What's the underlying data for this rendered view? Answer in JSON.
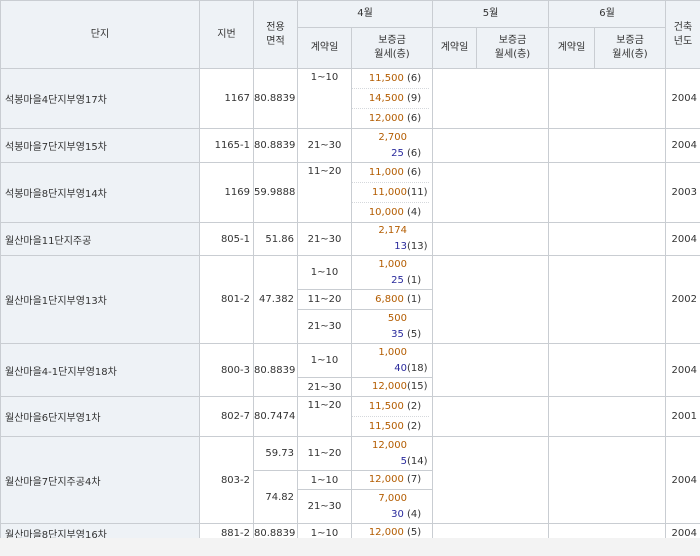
{
  "headers": {
    "danji": "단지",
    "jibun": "지번",
    "area": "전용\n면적",
    "month4": "4월",
    "month5": "5월",
    "month6": "6월",
    "year": "건축\n년도",
    "contract_day": "계약일",
    "deposit": "보증금\n월세(층)"
  },
  "rows": [
    {
      "name": "석봉마을4단지부영17차",
      "jibun": "1167",
      "area": "80.8839",
      "year": "2004"
    },
    {
      "name": "석봉마을7단지부영15차",
      "jibun": "1165-1",
      "area": "80.8839",
      "year": "2004"
    },
    {
      "name": "석봉마을8단지부영14차",
      "jibun": "1169",
      "area": "59.9888",
      "year": "2003"
    },
    {
      "name": "월산마을11단지주공",
      "jibun": "805-1",
      "area": "51.86",
      "year": "2004"
    },
    {
      "name": "월산마을1단지부영13차",
      "jibun": "801-2",
      "area": "47.382",
      "year": "2002"
    },
    {
      "name": "월산마을4-1단지부영18차",
      "jibun": "800-3",
      "area": "80.8839",
      "year": "2004"
    },
    {
      "name": "월산마을6단지부영1차",
      "jibun": "802-7",
      "area": "80.7474",
      "year": "2001"
    },
    {
      "name": "월산마을7단지주공4차",
      "jibun": "803-2",
      "area": "59.73",
      "area2": "74.82",
      "year": "2004"
    },
    {
      "name": "월산마을8단지부영16차",
      "jibun": "881-2",
      "area": "80.8839",
      "year": "2004"
    }
  ],
  "deals": {
    "r0": {
      "d1": "1~10",
      "p": [
        {
          "dep": "11,500",
          "fl": "(6)"
        },
        {
          "dep": "14,500",
          "fl": "(9)"
        },
        {
          "dep": "12,000",
          "fl": "(6)"
        }
      ]
    },
    "r1": {
      "d1": "21~30",
      "dep": "2,700",
      "mon": "25",
      "fl": "(6)"
    },
    "r2": {
      "d1": "11~20",
      "p": [
        {
          "dep": "11,000",
          "fl": "(6)"
        },
        {
          "dep": "11,000",
          "fl": "(11)"
        },
        {
          "dep": "10,000",
          "fl": "(4)"
        }
      ]
    },
    "r3": {
      "d1": "21~30",
      "dep": "2,174",
      "mon": "13",
      "fl": "(13)"
    },
    "r4": {
      "d1": "1~10",
      "dep1": "1,000",
      "mon1": "25",
      "fl1": "(1)",
      "d2": "11~20",
      "dep2": "6,800",
      "fl2": "(1)",
      "d3": "21~30",
      "dep3": "500",
      "mon3": "35",
      "fl3": "(5)"
    },
    "r5": {
      "d1": "1~10",
      "dep1": "1,000",
      "mon1": "40",
      "fl1": "(18)",
      "d2": "21~30",
      "dep2": "12,000",
      "fl2": "(15)"
    },
    "r6": {
      "d1": "11~20",
      "dep1": "11,500",
      "fl1": "(2)",
      "dep2": "11,500",
      "fl2": "(2)"
    },
    "r7": {
      "d1": "11~20",
      "dep1": "12,000",
      "mon1": "5",
      "fl1": "(14)",
      "d2": "1~10",
      "dep2": "12,000",
      "fl2": "(7)",
      "d3": "21~30",
      "dep3": "7,000",
      "mon3": "30",
      "fl3": "(4)"
    },
    "r8": {
      "d1": "1~10",
      "dep": "12,000",
      "fl": "(5)"
    }
  }
}
